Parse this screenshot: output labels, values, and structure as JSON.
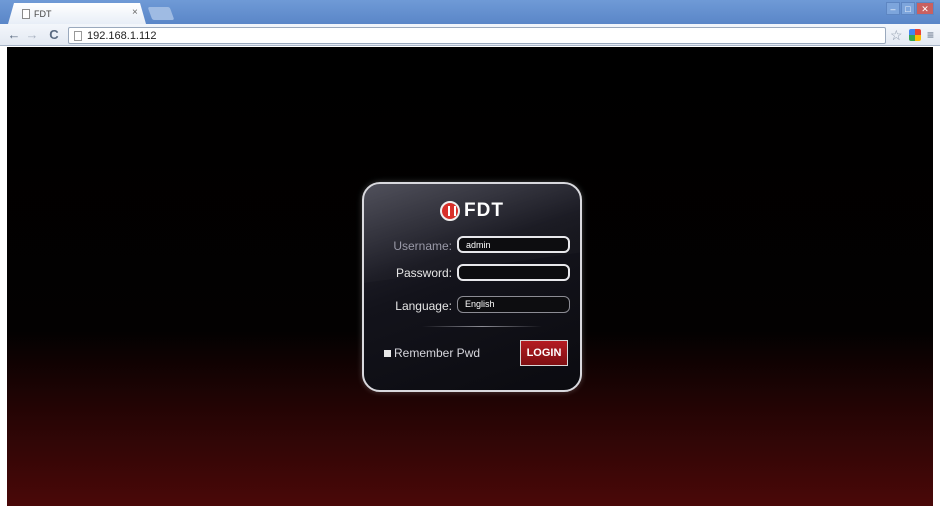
{
  "browser": {
    "tab_title": "FDT",
    "tab_close": "×",
    "url": "192.168.1.112",
    "window_controls": {
      "minimize": "–",
      "maximize": "□",
      "close": "✕"
    }
  },
  "toolbar": {
    "back_icon": "←",
    "forward_icon": "→",
    "reload_icon": "C",
    "star_icon": "☆",
    "menu_icon": "≡"
  },
  "login": {
    "brand": "FDT",
    "username_label": "Username:",
    "username_value": "admin",
    "password_label": "Password:",
    "password_value": "",
    "language_label": "Language:",
    "language_value": "English",
    "remember_label": "Remember Pwd",
    "login_button": "LOGIN"
  },
  "colors": {
    "login_button": "#9c161b",
    "background_top": "#000000",
    "background_bottom": "#4a0808",
    "brand_accent": "#d8302a"
  }
}
